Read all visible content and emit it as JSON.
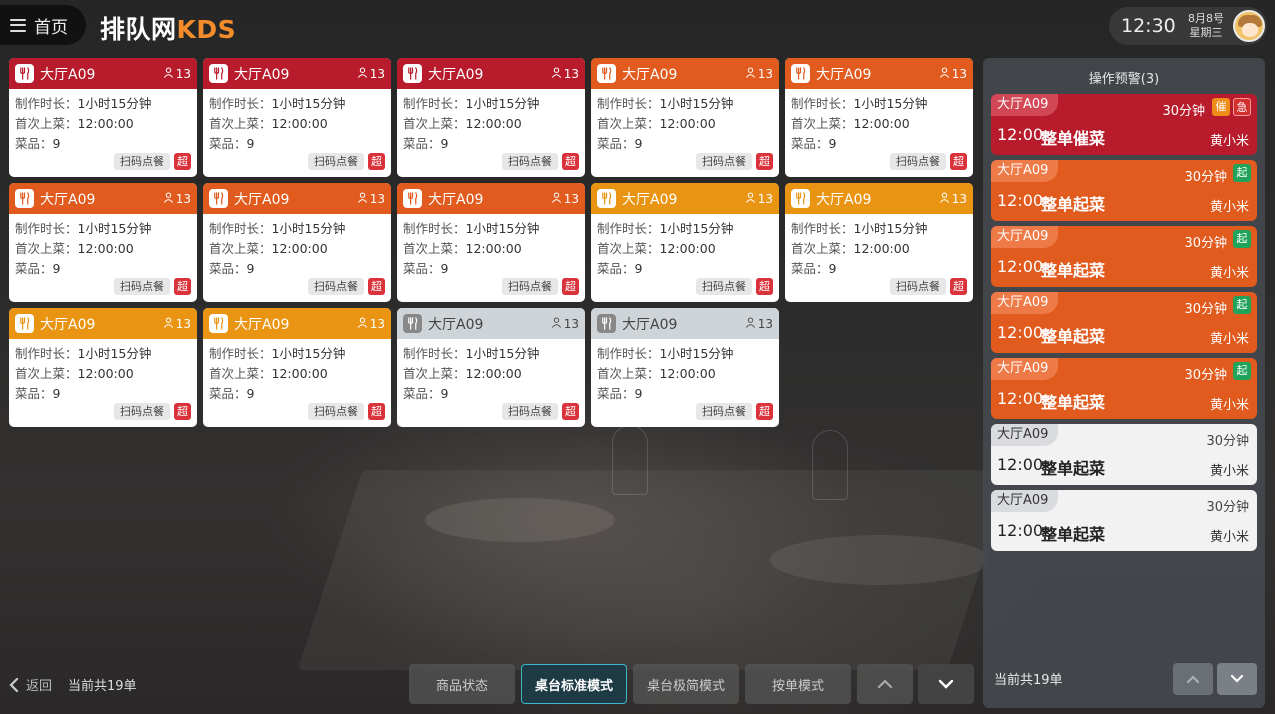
{
  "header": {
    "home_label": "首页",
    "logo_text": "排队网",
    "logo_accent": "KDS",
    "time": "12:30",
    "date": "8月8号",
    "weekday": "星期三"
  },
  "cards": [
    {
      "color": "red",
      "table": "大厅A09",
      "guests": "13",
      "duration_label": "制作时长：",
      "duration": "1小时15分钟",
      "first_serve_label": "首次上菜：",
      "first_serve": "12:00:00",
      "dishes_label": "菜品：",
      "dishes": "9",
      "source": "扫码点餐",
      "flag": "超"
    },
    {
      "color": "red",
      "table": "大厅A09",
      "guests": "13",
      "duration_label": "制作时长：",
      "duration": "1小时15分钟",
      "first_serve_label": "首次上菜：",
      "first_serve": "12:00:00",
      "dishes_label": "菜品：",
      "dishes": "9",
      "source": "扫码点餐",
      "flag": "超"
    },
    {
      "color": "red",
      "table": "大厅A09",
      "guests": "13",
      "duration_label": "制作时长：",
      "duration": "1小时15分钟",
      "first_serve_label": "首次上菜：",
      "first_serve": "12:00:00",
      "dishes_label": "菜品：",
      "dishes": "9",
      "source": "扫码点餐",
      "flag": "超"
    },
    {
      "color": "orange",
      "table": "大厅A09",
      "guests": "13",
      "duration_label": "制作时长：",
      "duration": "1小时15分钟",
      "first_serve_label": "首次上菜：",
      "first_serve": "12:00:00",
      "dishes_label": "菜品：",
      "dishes": "9",
      "source": "扫码点餐",
      "flag": "超"
    },
    {
      "color": "orange",
      "table": "大厅A09",
      "guests": "13",
      "duration_label": "制作时长：",
      "duration": "1小时15分钟",
      "first_serve_label": "首次上菜：",
      "first_serve": "12:00:00",
      "dishes_label": "菜品：",
      "dishes": "9",
      "source": "扫码点餐",
      "flag": "超"
    },
    {
      "color": "orange",
      "table": "大厅A09",
      "guests": "13",
      "duration_label": "制作时长：",
      "duration": "1小时15分钟",
      "first_serve_label": "首次上菜：",
      "first_serve": "12:00:00",
      "dishes_label": "菜品：",
      "dishes": "9",
      "source": "扫码点餐",
      "flag": "超"
    },
    {
      "color": "orange",
      "table": "大厅A09",
      "guests": "13",
      "duration_label": "制作时长：",
      "duration": "1小时15分钟",
      "first_serve_label": "首次上菜：",
      "first_serve": "12:00:00",
      "dishes_label": "菜品：",
      "dishes": "9",
      "source": "扫码点餐",
      "flag": "超"
    },
    {
      "color": "orange",
      "table": "大厅A09",
      "guests": "13",
      "duration_label": "制作时长：",
      "duration": "1小时15分钟",
      "first_serve_label": "首次上菜：",
      "first_serve": "12:00:00",
      "dishes_label": "菜品：",
      "dishes": "9",
      "source": "扫码点餐",
      "flag": "超"
    },
    {
      "color": "amber",
      "table": "大厅A09",
      "guests": "13",
      "duration_label": "制作时长：",
      "duration": "1小时15分钟",
      "first_serve_label": "首次上菜：",
      "first_serve": "12:00:00",
      "dishes_label": "菜品：",
      "dishes": "9",
      "source": "扫码点餐",
      "flag": "超"
    },
    {
      "color": "amber",
      "table": "大厅A09",
      "guests": "13",
      "duration_label": "制作时长：",
      "duration": "1小时15分钟",
      "first_serve_label": "首次上菜：",
      "first_serve": "12:00:00",
      "dishes_label": "菜品：",
      "dishes": "9",
      "source": "扫码点餐",
      "flag": "超"
    },
    {
      "color": "amber",
      "table": "大厅A09",
      "guests": "13",
      "duration_label": "制作时长：",
      "duration": "1小时15分钟",
      "first_serve_label": "首次上菜：",
      "first_serve": "12:00:00",
      "dishes_label": "菜品：",
      "dishes": "9",
      "source": "扫码点餐",
      "flag": "超"
    },
    {
      "color": "amber",
      "table": "大厅A09",
      "guests": "13",
      "duration_label": "制作时长：",
      "duration": "1小时15分钟",
      "first_serve_label": "首次上菜：",
      "first_serve": "12:00:00",
      "dishes_label": "菜品：",
      "dishes": "9",
      "source": "扫码点餐",
      "flag": "超"
    },
    {
      "color": "gray",
      "table": "大厅A09",
      "guests": "13",
      "duration_label": "制作时长：",
      "duration": "1小时15分钟",
      "first_serve_label": "首次上菜：",
      "first_serve": "12:00:00",
      "dishes_label": "菜品：",
      "dishes": "9",
      "source": "扫码点餐",
      "flag": "超"
    },
    {
      "color": "gray",
      "table": "大厅A09",
      "guests": "13",
      "duration_label": "制作时长：",
      "duration": "1小时15分钟",
      "first_serve_label": "首次上菜：",
      "first_serve": "12:00:00",
      "dishes_label": "菜品：",
      "dishes": "9",
      "source": "扫码点餐",
      "flag": "超"
    }
  ],
  "panel": {
    "title": "操作预警(3)",
    "alerts": [
      {
        "color": "red",
        "table": "大厅A09",
        "minutes": "30分钟",
        "badges": [
          "催",
          "急"
        ],
        "time": "12:00",
        "action": "整单催菜",
        "person": "黄小米"
      },
      {
        "color": "orange",
        "table": "大厅A09",
        "minutes": "30分钟",
        "badges": [
          "起"
        ],
        "time": "12:00",
        "action": "整单起菜",
        "person": "黄小米"
      },
      {
        "color": "orange",
        "table": "大厅A09",
        "minutes": "30分钟",
        "badges": [
          "起"
        ],
        "time": "12:00",
        "action": "整单起菜",
        "person": "黄小米"
      },
      {
        "color": "orange",
        "table": "大厅A09",
        "minutes": "30分钟",
        "badges": [
          "起"
        ],
        "time": "12:00",
        "action": "整单起菜",
        "person": "黄小米"
      },
      {
        "color": "orange",
        "table": "大厅A09",
        "minutes": "30分钟",
        "badges": [
          "起"
        ],
        "time": "12:00",
        "action": "整单起菜",
        "person": "黄小米"
      },
      {
        "color": "white",
        "table": "大厅A09",
        "minutes": "30分钟",
        "badges": [],
        "time": "12:00",
        "action": "整单起菜",
        "person": "黄小米"
      },
      {
        "color": "white",
        "table": "大厅A09",
        "minutes": "30分钟",
        "badges": [],
        "time": "12:00",
        "action": "整单起菜",
        "person": "黄小米"
      }
    ],
    "count": "当前共19单"
  },
  "footer": {
    "back_label": "返回",
    "count": "当前共19单",
    "modes": [
      "商品状态",
      "桌台标准模式",
      "桌台极简模式",
      "按单模式"
    ],
    "active_mode": "桌台标准模式"
  },
  "colors": {
    "red": "#b81c2c",
    "orange": "#e15a1e",
    "amber": "#e99513",
    "gray": "#cfd4d8",
    "accent": "#f28c2b",
    "active_border": "#3bb7c7"
  }
}
